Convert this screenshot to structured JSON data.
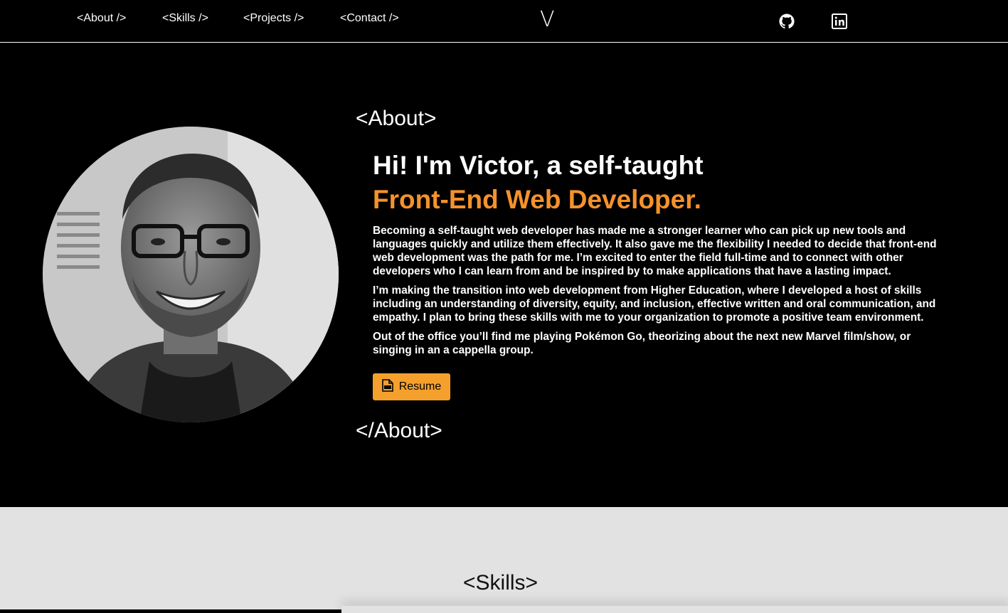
{
  "nav": {
    "links": [
      "<About />",
      "<Skills />",
      "<Projects />",
      "<Contact />"
    ],
    "logo": "V",
    "social": [
      "github-icon",
      "linkedin-icon"
    ]
  },
  "about": {
    "open_tag": "<About>",
    "close_tag": "</About>",
    "headline": "Hi! I'm Victor, a self-taught",
    "headline_accent": "Front-End Web Developer.",
    "accent_color": "#f5922c",
    "paragraphs": [
      "Becoming a self-taught web developer has made me a stronger learner who can pick up new tools and languages quickly and utilize them effectively. It also gave me the flexibility I needed to decide that front-end web development was the path for me. I’m excited to enter the field full-time and to connect with other developers who I can learn from and be inspired by to make applications that have a lasting impact.",
      "I’m making the transition into web development from Higher Education, where I developed a host of skills including an understanding of diversity, equity, and inclusion, effective written and oral communication, and empathy. I plan to bring these skills with me to your organization to promote a positive team environment.",
      "Out of the office you’ll find me playing Pokémon Go, theorizing about the next new Marvel film/show, or singing in an a cappella group."
    ],
    "resume_label": "Resume",
    "resume_icon": "pdf-icon",
    "resume_color": "#f5a02c"
  },
  "skills": {
    "title": "<Skills>"
  }
}
